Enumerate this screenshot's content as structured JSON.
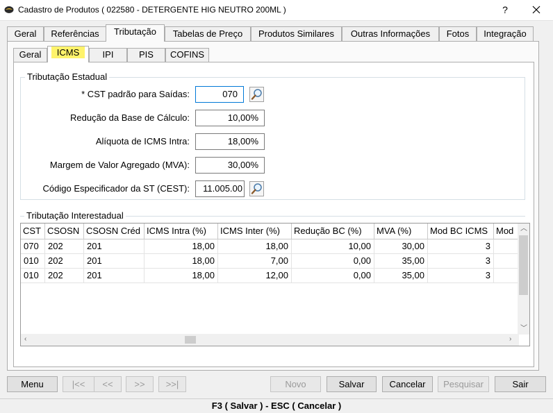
{
  "window": {
    "title": "Cadastro de Produtos ( 022580 - DETERGENTE HIG NEUTRO 200ML )",
    "help_label": "?",
    "close_label": "✕"
  },
  "main_tabs": [
    {
      "label": "Geral",
      "active": false
    },
    {
      "label": "Referências",
      "active": false
    },
    {
      "label": "Tributação",
      "active": true
    },
    {
      "label": "Tabelas de Preço",
      "active": false
    },
    {
      "label": "Produtos Similares",
      "active": false
    },
    {
      "label": "Outras Informações",
      "active": false
    },
    {
      "label": "Fotos",
      "active": false
    },
    {
      "label": "Integração",
      "active": false
    }
  ],
  "sub_tabs": [
    {
      "label": "Geral",
      "active": false
    },
    {
      "label": "ICMS",
      "active": true
    },
    {
      "label": "IPI",
      "active": false
    },
    {
      "label": "PIS",
      "active": false
    },
    {
      "label": "COFINS",
      "active": false
    }
  ],
  "estadual": {
    "title": "Tributação Estadual",
    "fields": [
      {
        "label": "* CST padrão para Saídas:",
        "value": "070"
      },
      {
        "label": "Redução da Base de Cálculo:",
        "value": "10,00%"
      },
      {
        "label": "Alíquota de ICMS Intra:",
        "value": "18,00%"
      },
      {
        "label": "Margem de Valor Agregado (MVA):",
        "value": "30,00%"
      },
      {
        "label": "Código Especificador da ST (CEST):",
        "value": "11.005.00"
      }
    ]
  },
  "interestadual": {
    "title": "Tributação Interestadual",
    "columns": [
      "CST",
      "CSOSN",
      "CSOSN Créd",
      "ICMS Intra (%)",
      "ICMS Inter (%)",
      "Redução BC (%)",
      "MVA (%)",
      "Mod BC ICMS",
      "Mod"
    ],
    "rows": [
      [
        "070",
        "202",
        "201",
        "18,00",
        "18,00",
        "10,00",
        "30,00",
        "3",
        ""
      ],
      [
        "010",
        "202",
        "201",
        "18,00",
        "7,00",
        "0,00",
        "35,00",
        "3",
        ""
      ],
      [
        "010",
        "202",
        "201",
        "18,00",
        "12,00",
        "0,00",
        "35,00",
        "3",
        ""
      ]
    ]
  },
  "buttons": {
    "menu": "Menu",
    "first": "|<<",
    "prev": "<<",
    "next": ">>",
    "last": ">>|",
    "novo": "Novo",
    "salvar": "Salvar",
    "cancelar": "Cancelar",
    "pesquisar": "Pesquisar",
    "sair": "Sair"
  },
  "statusbar": {
    "text": "F3 ( Salvar )   -   ESC ( Cancelar )"
  },
  "colors": {
    "highlight": "#fff36b",
    "focus_border": "#0078d7"
  }
}
